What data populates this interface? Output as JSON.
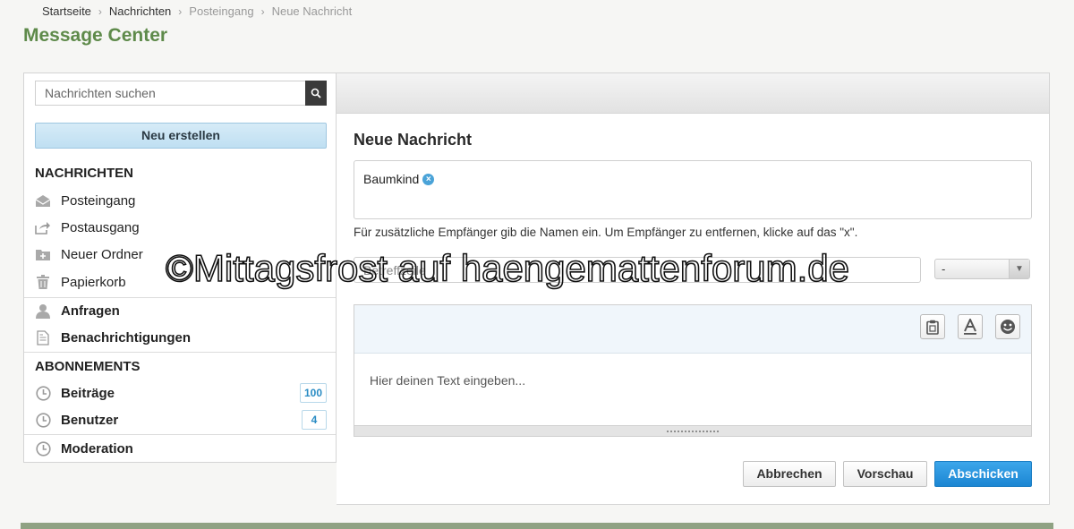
{
  "breadcrumb": {
    "home": "Startseite",
    "messages": "Nachrichten",
    "inbox": "Posteingang",
    "current": "Neue Nachricht"
  },
  "page_title": "Message Center",
  "sidebar": {
    "search_placeholder": "Nachrichten suchen",
    "new_button": "Neu erstellen",
    "messages_heading": "NACHRICHTEN",
    "items": [
      {
        "label": "Posteingang",
        "icon": "inbox-icon"
      },
      {
        "label": "Postausgang",
        "icon": "outbox-icon"
      },
      {
        "label": "Neuer Ordner",
        "icon": "new-folder-icon"
      },
      {
        "label": "Papierkorb",
        "icon": "trash-icon"
      }
    ],
    "requests": "Anfragen",
    "notifications": "Benachrichtigungen",
    "subscriptions_heading": "ABONNEMENTS",
    "subscriptions": [
      {
        "label": "Beiträge",
        "count": "100"
      },
      {
        "label": "Benutzer",
        "count": "4"
      }
    ],
    "moderation": "Moderation"
  },
  "compose": {
    "title": "Neue Nachricht",
    "recipient": "Baumkind",
    "recipient_remove": "×",
    "hint": "Für zusätzliche Empfänger gib die Namen ein. Um Empfänger zu entfernen, klicke auf das \"x\".",
    "subject_placeholder": "Betreffzeile",
    "select_value": "-",
    "editor_placeholder": "Hier deinen Text eingeben...",
    "buttons": {
      "cancel": "Abbrechen",
      "preview": "Vorschau",
      "send": "Abschicken"
    }
  },
  "watermark": "©Mittagsfrost auf haengemattenforum.de",
  "colors": {
    "title_green": "#5e8a4a",
    "primary_blue": "#1b86d3",
    "badge_blue": "#2a8cc4"
  }
}
